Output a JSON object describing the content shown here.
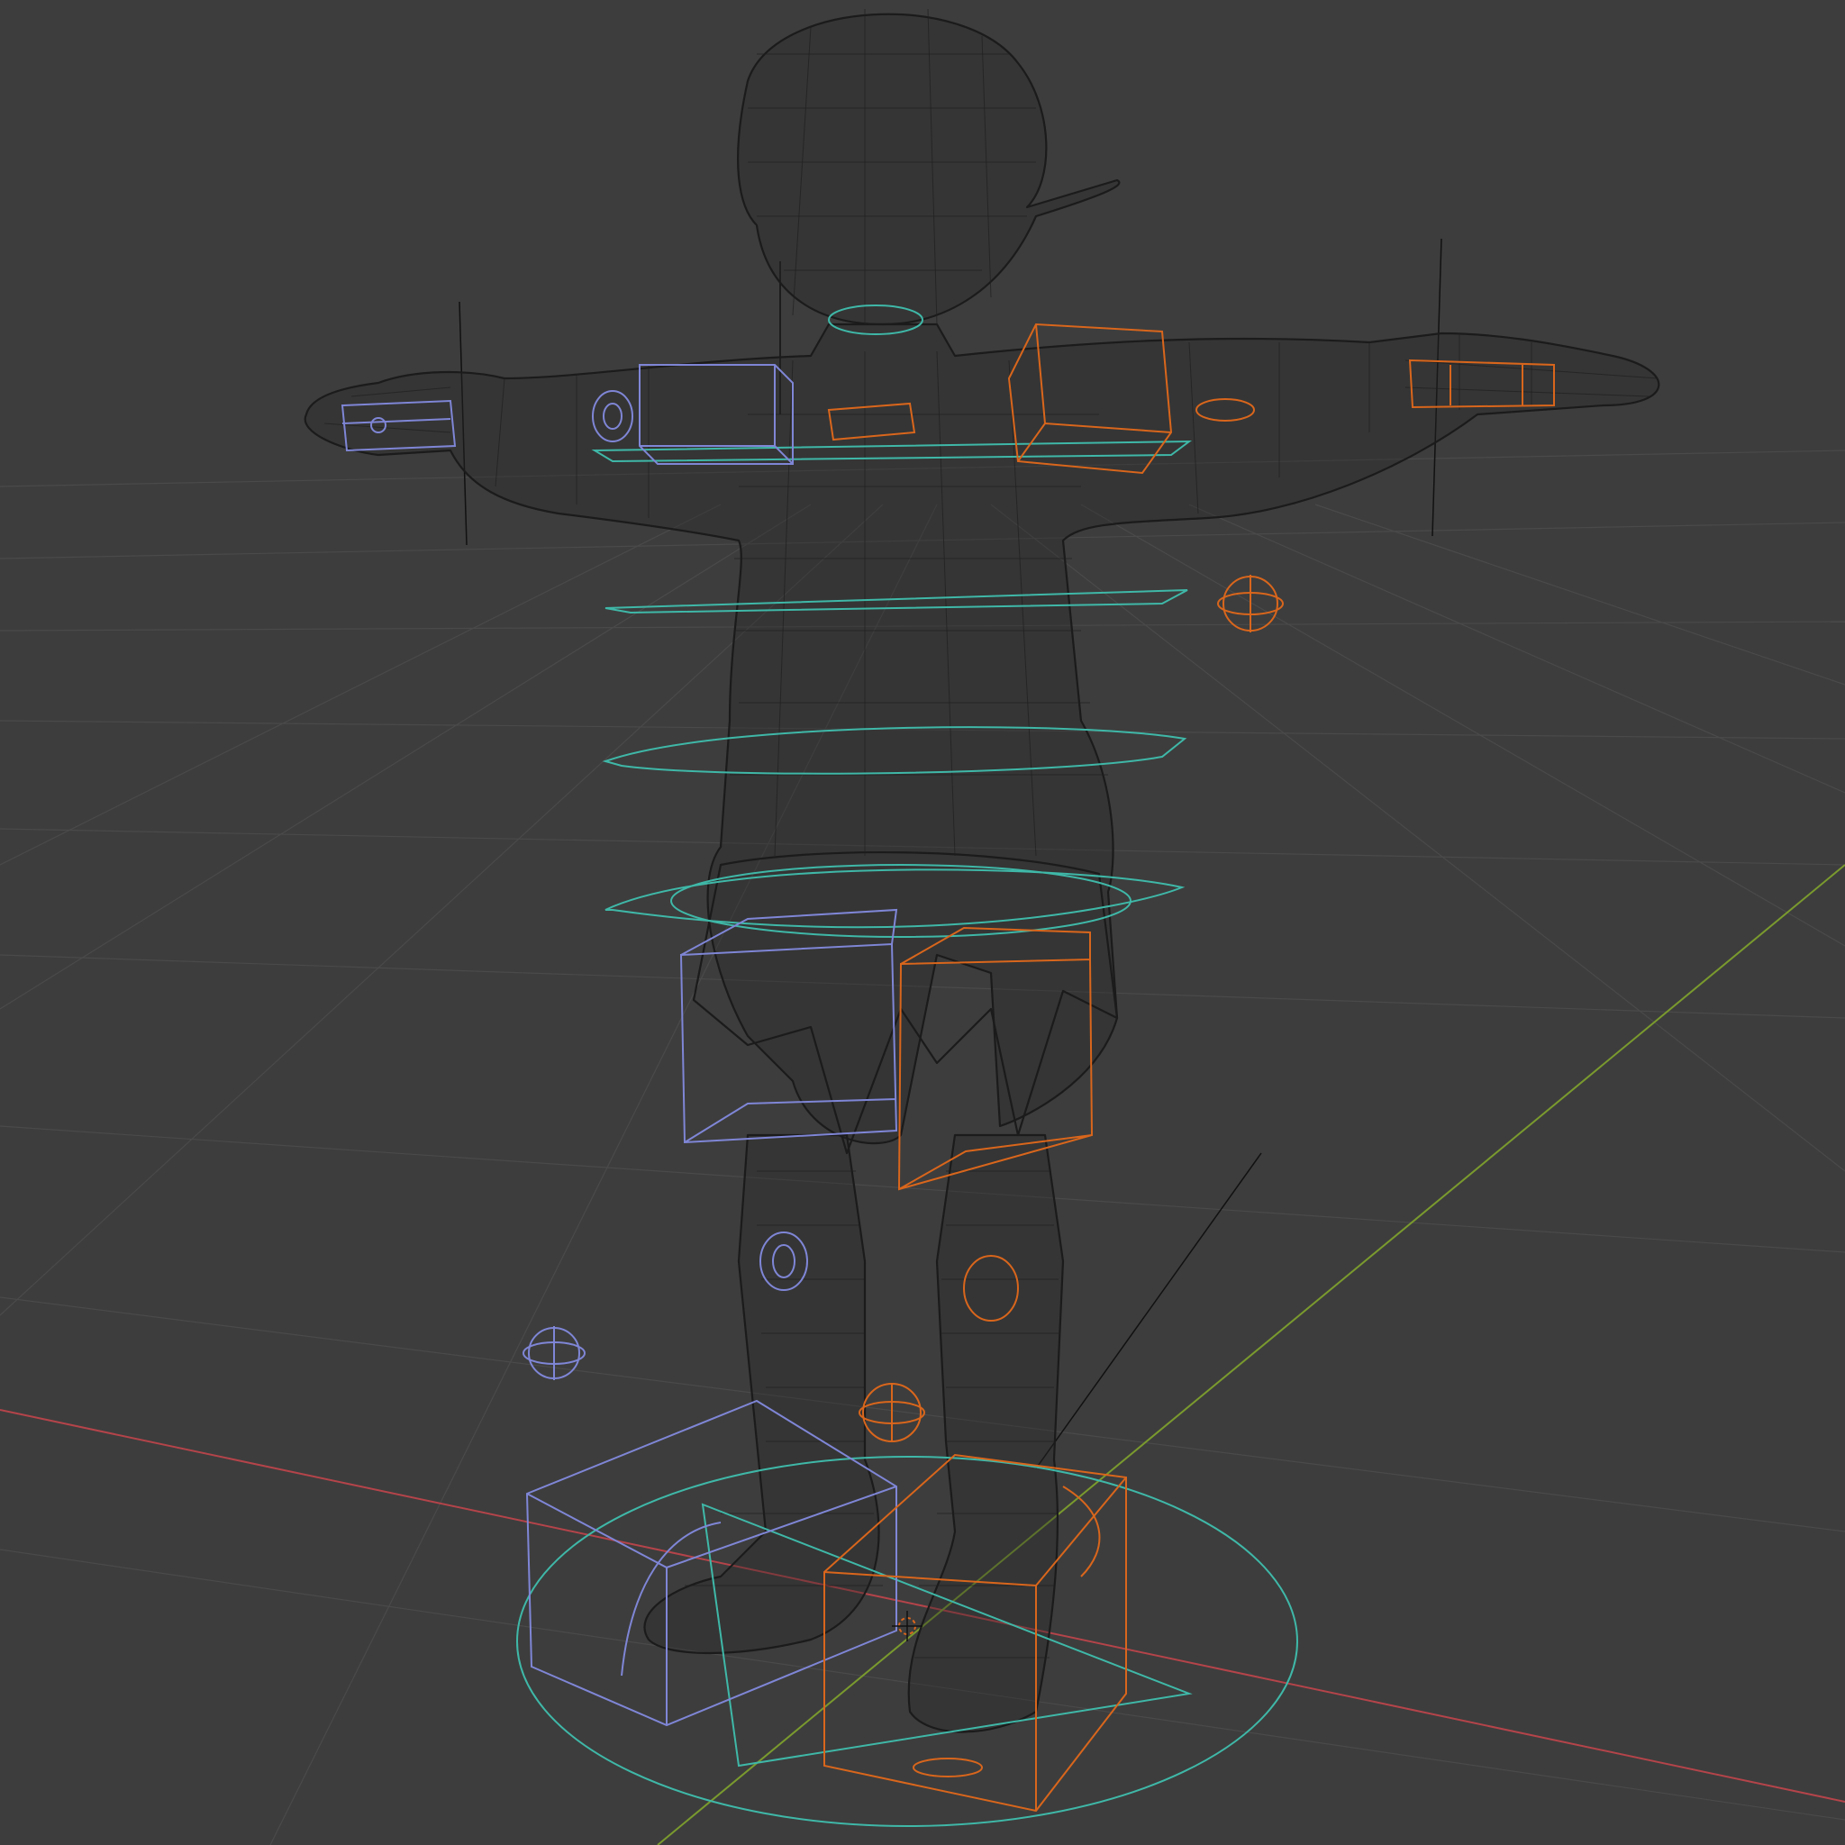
{
  "viewport": {
    "background": "#3d3d3d",
    "grid_color": "#4a4a4a",
    "axis_x_color": "#b4444a",
    "axis_y_color": "#7a9a2e"
  },
  "rig": {
    "teal_color": "#3fb8a8",
    "orange_color": "#d9661c",
    "blue_color": "#7f86d6",
    "mesh_color": "#1b1b1b"
  },
  "icons": {
    "cursor": "3d-cursor-icon"
  }
}
